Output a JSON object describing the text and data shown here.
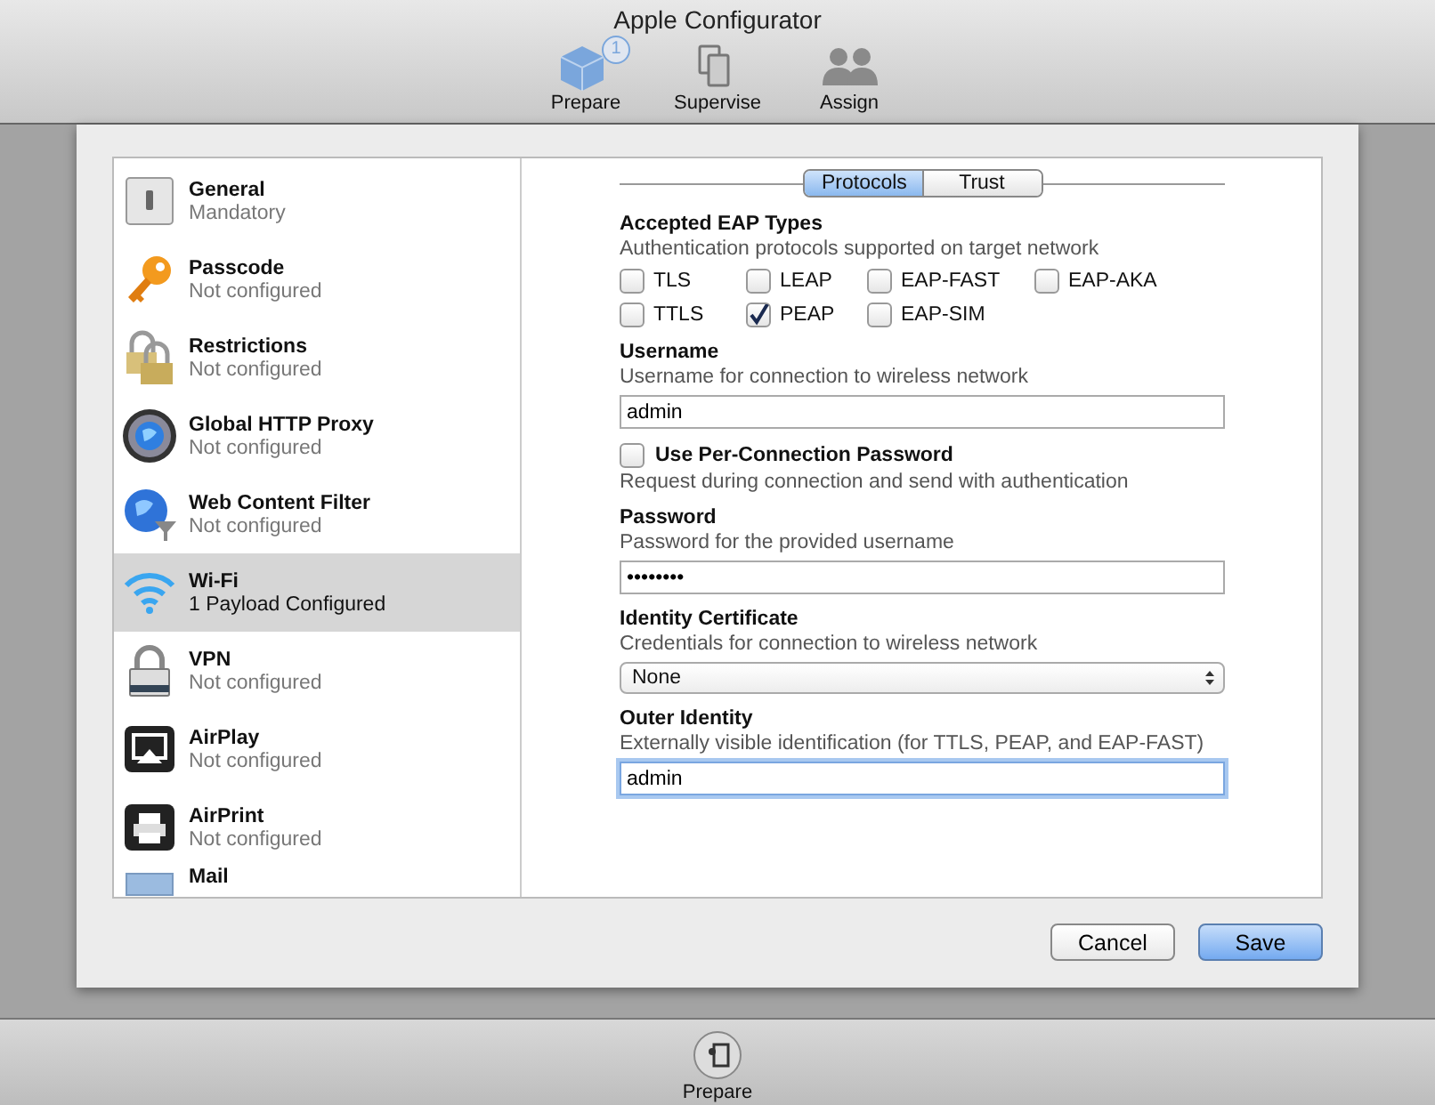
{
  "window": {
    "title": "Apple Configurator"
  },
  "toolbar": [
    {
      "label": "Prepare",
      "selected": true,
      "badge": "1"
    },
    {
      "label": "Supervise",
      "selected": false
    },
    {
      "label": "Assign",
      "selected": false
    }
  ],
  "sidebar": {
    "items": [
      {
        "title": "General",
        "subtitle": "Mandatory",
        "selected": false
      },
      {
        "title": "Passcode",
        "subtitle": "Not configured",
        "selected": false
      },
      {
        "title": "Restrictions",
        "subtitle": "Not configured",
        "selected": false
      },
      {
        "title": "Global HTTP Proxy",
        "subtitle": "Not configured",
        "selected": false
      },
      {
        "title": "Web Content Filter",
        "subtitle": "Not configured",
        "selected": false
      },
      {
        "title": "Wi-Fi",
        "subtitle": "1 Payload Configured",
        "selected": true
      },
      {
        "title": "VPN",
        "subtitle": "Not configured",
        "selected": false
      },
      {
        "title": "AirPlay",
        "subtitle": "Not configured",
        "selected": false
      },
      {
        "title": "AirPrint",
        "subtitle": "Not configured",
        "selected": false
      },
      {
        "title": "Mail",
        "selected": false
      }
    ]
  },
  "tabs": [
    {
      "label": "Protocols",
      "selected": true
    },
    {
      "label": "Trust",
      "selected": false
    }
  ],
  "form": [
    {
      "kind": "checkgroup",
      "label": "Accepted EAP Types",
      "description": "Authentication protocols supported on target network",
      "options": [
        {
          "label": "TLS",
          "checked": false
        },
        {
          "label": "LEAP",
          "checked": false
        },
        {
          "label": "EAP-FAST",
          "checked": false
        },
        {
          "label": "EAP-AKA",
          "checked": false
        },
        {
          "label": "TTLS",
          "checked": false
        },
        {
          "label": "PEAP",
          "checked": true
        },
        {
          "label": "EAP-SIM",
          "checked": false
        }
      ]
    },
    {
      "kind": "text",
      "label": "Username",
      "description": "Username for connection to wireless network",
      "value": "admin",
      "focused": false
    },
    {
      "kind": "checkbox",
      "label": "Use Per-Connection Password",
      "description": "Request during connection and send with authentication",
      "checked": false
    },
    {
      "kind": "text",
      "label": "Password",
      "description": "Password for the provided username",
      "value": "••••••••",
      "focused": false
    },
    {
      "kind": "select",
      "label": "Identity Certificate",
      "description": "Credentials for connection to wireless network",
      "value": "None"
    },
    {
      "kind": "text",
      "label": "Outer Identity",
      "description": "Externally visible identification (for TTLS, PEAP, and EAP-FAST)",
      "value": "admin",
      "focused": true
    }
  ],
  "buttons": [
    {
      "label": "Cancel",
      "default": false
    },
    {
      "label": "Save",
      "default": true
    }
  ],
  "bottom_bar": {
    "label": "Prepare"
  }
}
